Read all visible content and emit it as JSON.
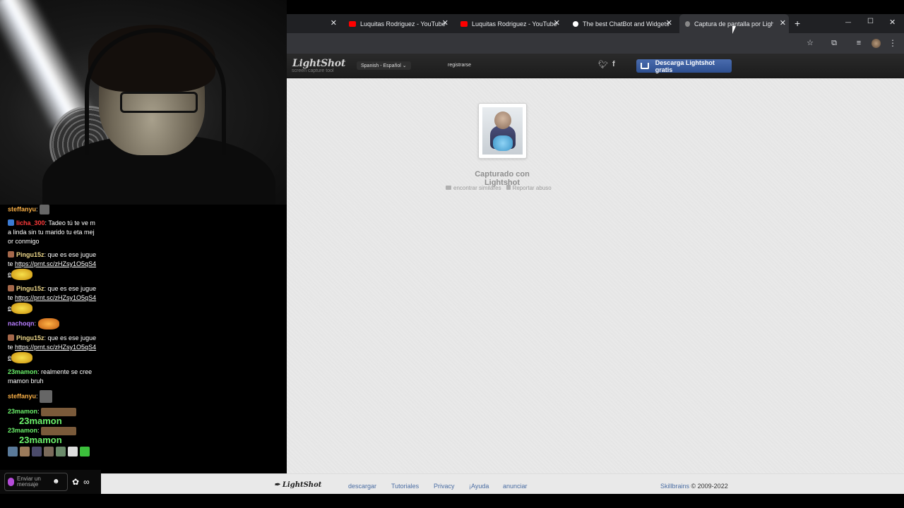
{
  "chat": {
    "messages": [
      {
        "user": "steffanyu",
        "sep": ":",
        "text": "",
        "color": "#ffb347"
      },
      {
        "user": "licha_300",
        "sep": ":",
        "text": " Tadeo tú te ve ma linda sin tu marido tu eta mejor conmigo",
        "color": "#ff3b3b"
      },
      {
        "user": "Pingu15z",
        "sep": ":",
        "text": " que es ese juguete",
        "link": "https://prnt.sc/zHZsy1O5qS4e",
        "color": "#f0d98a"
      },
      {
        "user": "Pingu15z",
        "sep": ":",
        "text": " que es ese juguete",
        "link": "https://prnt.sc/zHZsy1O5qS4e",
        "color": "#f0d98a"
      },
      {
        "user": "nachoqn",
        "sep": ":",
        "text": "",
        "color": "#b77dff"
      },
      {
        "user": "Pingu15z",
        "sep": ":",
        "text": " que es ese juguete",
        "link": "https://prnt.sc/zHZsy1O5qS4e",
        "color": "#f0d98a"
      },
      {
        "user": "23mamon",
        "sep": ":",
        "text": " realmente se cree mamon bruh",
        "color": "#6cf26c"
      },
      {
        "user": "steffanyu",
        "sep": ":",
        "text": "",
        "color": "#ffb347"
      },
      {
        "user": "23mamon",
        "sep": ":",
        "text": "",
        "color": "#6cf26c"
      },
      {
        "user": "23mamon",
        "sep": ":",
        "text": "",
        "color": "#6cf26c"
      }
    ],
    "big_label": "23mamon",
    "big_label2": "23mamon",
    "input_placeholder": "Enviar un mensaje",
    "infinity": "∞"
  },
  "browser": {
    "tabs": [
      {
        "title": "",
        "favicon": "none"
      },
      {
        "title": "Luquitas Rodriguez - YouTube",
        "favicon": "youtube-icon"
      },
      {
        "title": "Luquitas Rodriguez - YouTube",
        "favicon": "youtube-icon"
      },
      {
        "title": "The best ChatBot and Widgets",
        "favicon": "streamelements-icon"
      },
      {
        "title": "Captura de pantalla por Lightsh",
        "favicon": "lightshot-icon"
      }
    ],
    "close_glyph": "✕",
    "new_tab": "+",
    "window_controls": [
      "—",
      "☐",
      "✕"
    ]
  },
  "lightshot": {
    "logo": "LightShot",
    "logo_sub": "screen capture tool",
    "language": "Spanish - Español",
    "register": "registrarse",
    "download_button": "Descarga Lightshot gratis",
    "captured_with": "Capturado con Lightshot",
    "find_similar": "encontrar similares",
    "report_abuse": "Reportar abuso",
    "footer": {
      "logo": "LightShot",
      "links": [
        "descargar",
        "Tutoriales",
        "Privacy",
        "¡Ayuda",
        "anunciar"
      ],
      "company": "Skillbrains",
      "copyright": "© 2009-2022"
    }
  },
  "colors": {
    "accent_button": "#3b5da0",
    "page_bg": "#e9e9e9",
    "link": "#4a6da3"
  }
}
